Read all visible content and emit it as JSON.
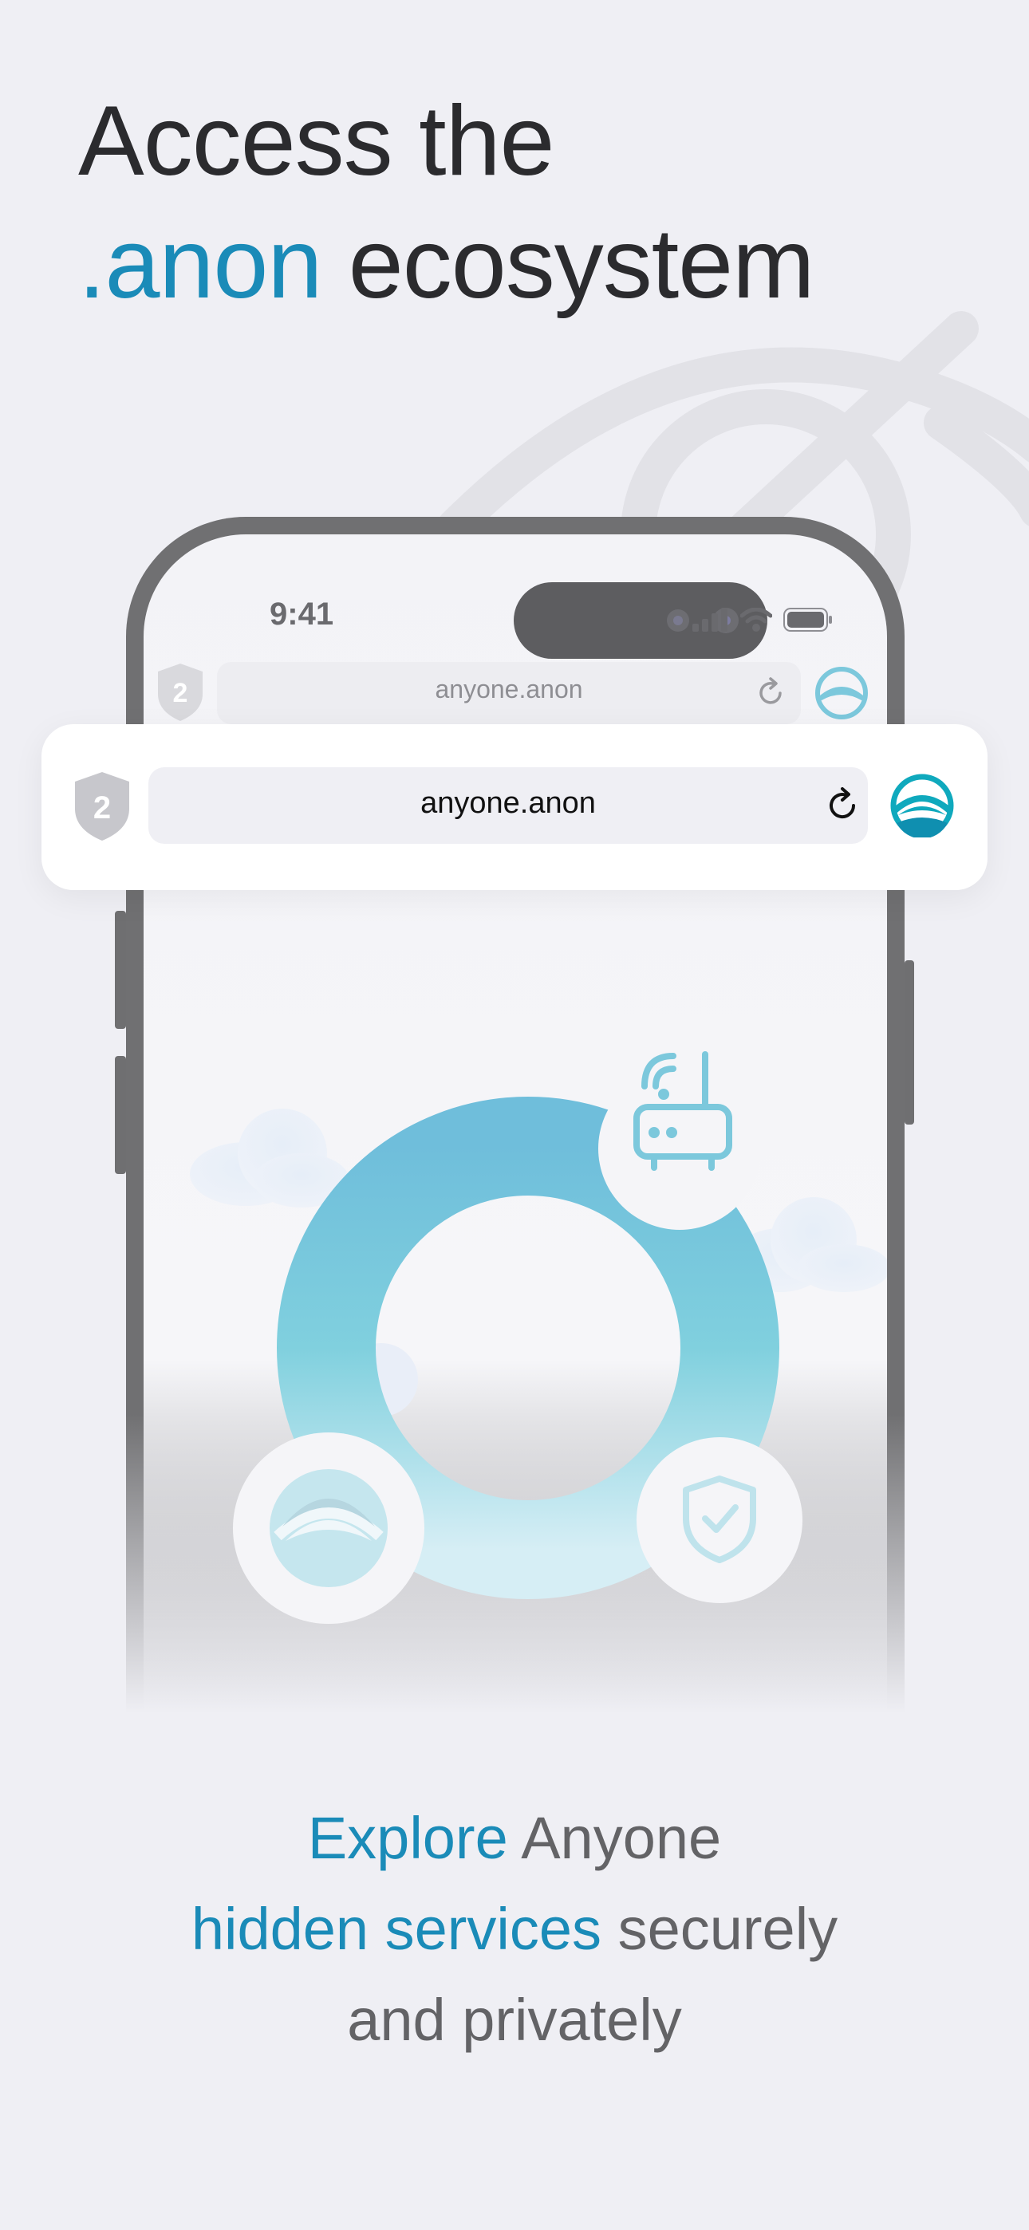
{
  "headline": {
    "line1": "Access the",
    "accent": ".anon",
    "line2_rest": " ecosystem"
  },
  "phone": {
    "time": "9:41",
    "ghost_url": "anyone.anon",
    "ghost_tab_count": "2"
  },
  "browser_bar": {
    "tab_count": "2",
    "url": "anyone.anon"
  },
  "tagline": {
    "accent1": "Explore",
    "text1": " Anyone",
    "accent2": "hidden services",
    "text2": " securely",
    "text3": "and privately"
  },
  "colors": {
    "accent": "#1a8bb8",
    "teal": "#0fa9bd",
    "ring": "#7cc8dc"
  },
  "icons": [
    "eye-slash-icon",
    "shield-icon",
    "reload-icon",
    "anyone-logo-icon",
    "router-icon",
    "shield-check-icon",
    "cloud-icon",
    "signal-icon",
    "wifi-icon",
    "battery-icon"
  ]
}
